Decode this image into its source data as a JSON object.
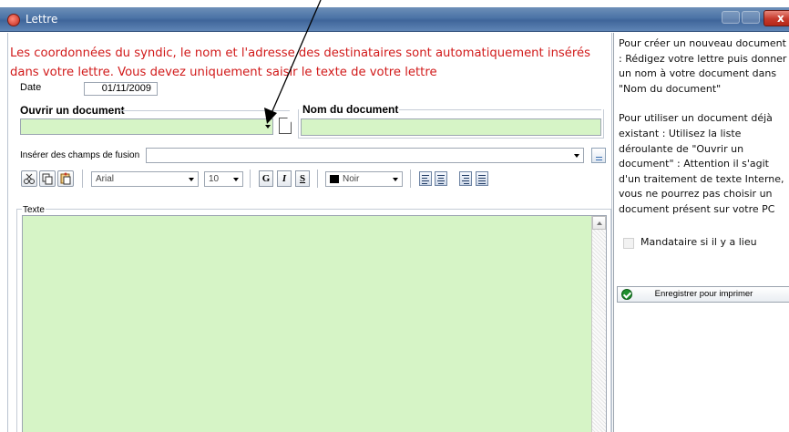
{
  "window": {
    "title": "Lettre",
    "close_glyph": "x"
  },
  "intro_text": "Les coordonnées du syndic, le nom et l'adresse des destinataires sont automatiquement insérés dans votre lettre. Vous devez uniquement saisir le texte de votre lettre",
  "date": {
    "label": "Date",
    "value": "01/11/2009"
  },
  "open_document": {
    "label": "Ouvrir un document",
    "value": ""
  },
  "document_name": {
    "label": "Nom du document",
    "value": ""
  },
  "merge_fields": {
    "label": "Insérer des champs de fusion",
    "value": ""
  },
  "toolbar": {
    "font": "Arial",
    "size": "10",
    "bold": "G",
    "italic": "I",
    "strike": "S",
    "color": "Noir",
    "color_hex": "#000000"
  },
  "body_text": {
    "label": "Texte",
    "value": ""
  },
  "side": {
    "help_new": "Pour créer un nouveau document : Rédigez votre lettre puis donner un nom à votre document dans \"Nom du document\"",
    "help_existing": "Pour utiliser un document déjà existant : Utilisez la liste déroulante de \"Ouvrir un document\" : Attention il s'agit d'un traitement de texte Interne, vous ne pourrez pas choisir un document présent sur votre PC",
    "mandataire_label": "Mandataire si il y a lieu",
    "save_button": "Enregistrer pour imprimer"
  },
  "colors": {
    "red_text": "#d11a1a",
    "field_green": "#d6f4c6",
    "titlebar": "#4b73a6"
  },
  "icons": [
    "app-icon",
    "new-document-icon",
    "merge-field-icon",
    "cut-icon",
    "copy-icon",
    "paste-icon",
    "align-left-icon",
    "align-center-icon",
    "align-right-icon",
    "justify-icon",
    "check-icon"
  ]
}
